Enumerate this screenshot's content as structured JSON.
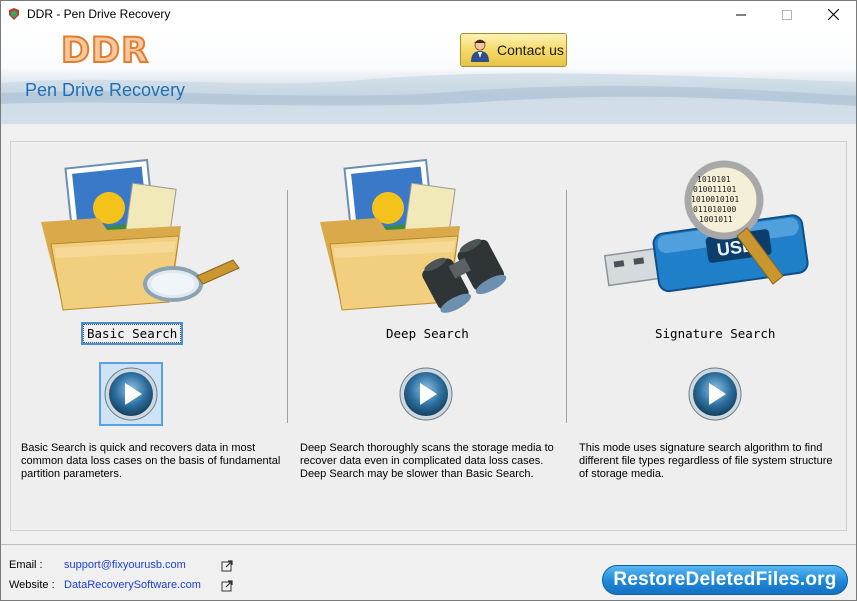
{
  "window": {
    "title": "DDR - Pen Drive Recovery"
  },
  "header": {
    "logo": "DDR",
    "subtitle": "Pen Drive Recovery",
    "contact_label": "Contact us"
  },
  "modes": [
    {
      "label": "Basic Search",
      "description": "Basic Search is quick and recovers data in most common data loss cases on the basis of fundamental partition parameters.",
      "icon": "folder-magnifier-icon",
      "focused": true
    },
    {
      "label": "Deep Search",
      "description": "Deep Search thoroughly scans the storage media to recover data even in complicated data loss cases. Deep Search may be slower than Basic Search.",
      "icon": "folder-binoculars-icon",
      "focused": false
    },
    {
      "label": "Signature Search",
      "description": "This mode uses signature search algorithm to find different file types regardless of file system structure of storage media.",
      "icon": "usb-magnifier-icon",
      "focused": false
    }
  ],
  "footer": {
    "email_label": "Email :",
    "email_value": "support@fixyourusb.com",
    "website_label": "Website :",
    "website_value": "DataRecoverySoftware.com",
    "brand": "RestoreDeletedFiles.org"
  },
  "colors": {
    "accent_blue": "#1e6fb7",
    "logo_orange": "#e07d2f",
    "link_blue": "#1a3fd6",
    "focus_blue": "#4a90d9"
  }
}
